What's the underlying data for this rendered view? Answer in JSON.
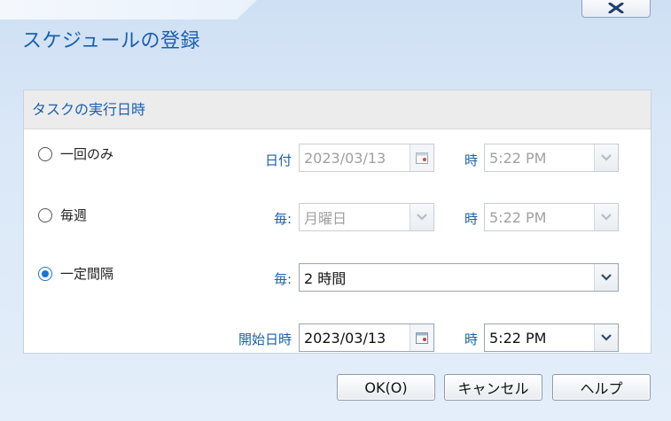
{
  "dialog": {
    "title": "スケジュールの登録"
  },
  "panel": {
    "header": "タスクの実行日時"
  },
  "options": {
    "once": {
      "label": "一回のみ",
      "selected": false
    },
    "weekly": {
      "label": "毎週",
      "selected": false
    },
    "interval": {
      "label": "一定間隔",
      "selected": true
    }
  },
  "once_fields": {
    "date_label": "日付",
    "date_value": "2023/03/13",
    "time_label": "時",
    "time_value": "5:22 PM"
  },
  "weekly_fields": {
    "every_label": "毎:",
    "day_value": "月曜日",
    "time_label": "時",
    "time_value": "5:22 PM"
  },
  "interval_fields": {
    "every_label": "毎:",
    "interval_value": "2 時間",
    "start_label": "開始日時",
    "start_date_value": "2023/03/13",
    "time_label": "時",
    "time_value": "5:22 PM"
  },
  "buttons": {
    "ok": "OK(O)",
    "cancel": "キャンセル",
    "help": "ヘルプ"
  },
  "colors": {
    "accent": "#1b5fae",
    "radio_selected": "#1a73d6",
    "disabled_text": "#a0a0a0"
  },
  "icons": {
    "close": "close-icon",
    "calendar": "calendar-icon",
    "dropdown": "chevron-down-icon"
  }
}
